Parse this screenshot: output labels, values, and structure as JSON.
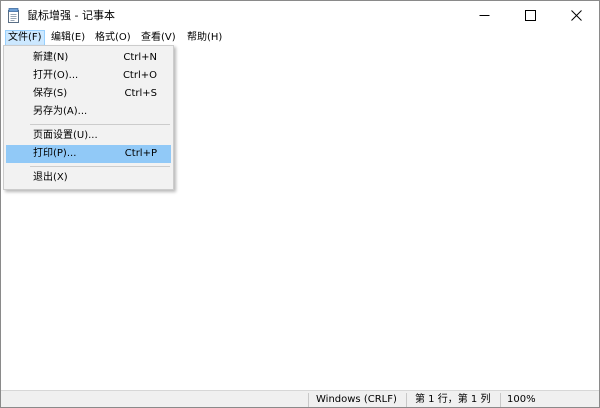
{
  "window": {
    "title": "鼠标增强 - 记事本"
  },
  "menubar": {
    "items": [
      {
        "label": "文件(F)"
      },
      {
        "label": "编辑(E)"
      },
      {
        "label": "格式(O)"
      },
      {
        "label": "查看(V)"
      },
      {
        "label": "帮助(H)"
      }
    ]
  },
  "file_menu": {
    "items": [
      {
        "label": "新建(N)",
        "shortcut": "Ctrl+N"
      },
      {
        "label": "打开(O)...",
        "shortcut": "Ctrl+O"
      },
      {
        "label": "保存(S)",
        "shortcut": "Ctrl+S"
      },
      {
        "label": "另存为(A)...",
        "shortcut": ""
      },
      {
        "label": "页面设置(U)...",
        "shortcut": ""
      },
      {
        "label": "打印(P)...",
        "shortcut": "Ctrl+P"
      },
      {
        "label": "退出(X)",
        "shortcut": ""
      }
    ],
    "highlighted_item": "打印(P)..."
  },
  "statusbar": {
    "line_ending": "Windows (CRLF)",
    "position": "第 1 行，第 1 列",
    "zoom": "100%"
  },
  "icons": {
    "app": "notepad-icon",
    "minimize": "minimize-icon",
    "maximize": "maximize-icon",
    "close": "close-icon"
  },
  "colors": {
    "menu_highlight": "#91c9f7",
    "menubar_active": "#cce8ff"
  }
}
